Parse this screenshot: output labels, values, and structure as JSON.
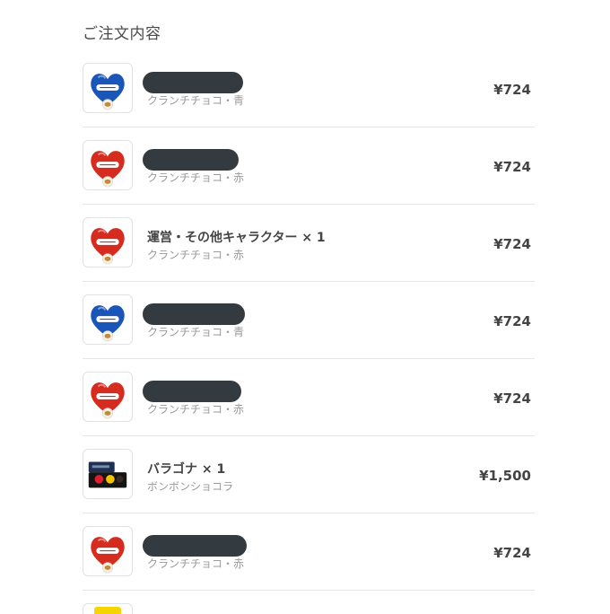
{
  "section": {
    "title": "ご注文内容"
  },
  "items": [
    {
      "name": "",
      "redacted": true,
      "variant": "クランチチョコ・青",
      "price": "¥724",
      "thumb": "blue-heart-chocolate-icon",
      "color": "#1a56b8"
    },
    {
      "name": "",
      "redacted": true,
      "variant": "クランチチョコ・赤",
      "price": "¥724",
      "thumb": "red-heart-chocolate-icon",
      "color": "#d62b1f"
    },
    {
      "name": "運営・その他キャラクター × 1",
      "redacted": false,
      "variant": "クランチチョコ・赤",
      "price": "¥724",
      "thumb": "red-heart-chocolate-icon",
      "color": "#d62b1f"
    },
    {
      "name": "",
      "redacted": true,
      "variant": "クランチチョコ・青",
      "price": "¥724",
      "thumb": "blue-heart-chocolate-icon",
      "color": "#1a56b8"
    },
    {
      "name": "",
      "redacted": true,
      "variant": "クランチチョコ・赤",
      "price": "¥724",
      "thumb": "red-heart-chocolate-icon",
      "color": "#d62b1f"
    },
    {
      "name": "バラゴナ × 1",
      "redacted": false,
      "variant": "ボンボンショコラ",
      "price": "¥1,500",
      "thumb": "bonbon-chocolate-box-icon",
      "color": "#1f3050"
    },
    {
      "name": "",
      "redacted": true,
      "variant": "クランチチョコ・赤",
      "price": "¥724",
      "thumb": "red-heart-chocolate-icon",
      "color": "#d62b1f"
    }
  ],
  "partial_item": {
    "thumb": "yellow-product-icon",
    "color": "#f5d400"
  }
}
